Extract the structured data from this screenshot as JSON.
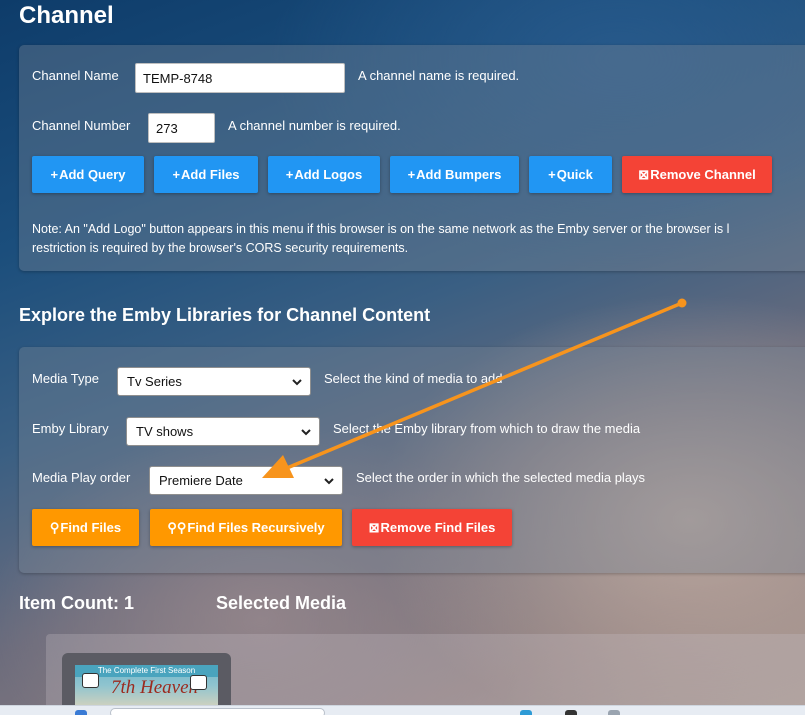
{
  "page": {
    "title": "Channel"
  },
  "channel": {
    "name_label": "Channel Name",
    "name_value": "TEMP-8748",
    "name_hint": "A channel name is required.",
    "number_label": "Channel Number",
    "number_value": "273",
    "number_hint": "A channel number is required.",
    "buttons": {
      "add_query": "Add Query",
      "add_files": "Add Files",
      "add_logos": "Add Logos",
      "add_bumpers": "Add Bumpers",
      "quick": "Quick",
      "remove_channel": "Remove Channel"
    },
    "note_line1": "Note: An \"Add Logo\" button appears in this menu if this browser is on the same network as the Emby server or the browser is l",
    "note_line2": "restriction is required by the browser's CORS security requirements."
  },
  "explore": {
    "title": "Explore the Emby Libraries for Channel Content",
    "media_type_label": "Media Type",
    "media_type_value": "Tv Series",
    "media_type_hint": "Select the kind of media to add",
    "library_label": "Emby Library",
    "library_value": "TV shows",
    "library_hint": "Select the Emby library from which to draw the media",
    "play_order_label": "Media Play order",
    "play_order_value": "Premiere Date",
    "play_order_hint": "Select the order in which the selected media plays",
    "buttons": {
      "find_files": "Find Files",
      "find_files_recursive": "Find Files Recursively",
      "remove_find_files": "Remove Find Files"
    }
  },
  "results": {
    "item_count_label": "Item Count: 1",
    "selected_media_label": "Selected Media",
    "thumb_banner": "The Complete First Season",
    "thumb_title": "7th Heaven"
  },
  "colors": {
    "blue": "#2196f3",
    "red": "#f44336",
    "orange": "#ff9800",
    "annotation_arrow": "#f7941d"
  },
  "icons": {
    "plus": "plus-icon",
    "remove": "remove-box-icon",
    "search": "search-icon",
    "chevron": "chevron-down-icon"
  }
}
